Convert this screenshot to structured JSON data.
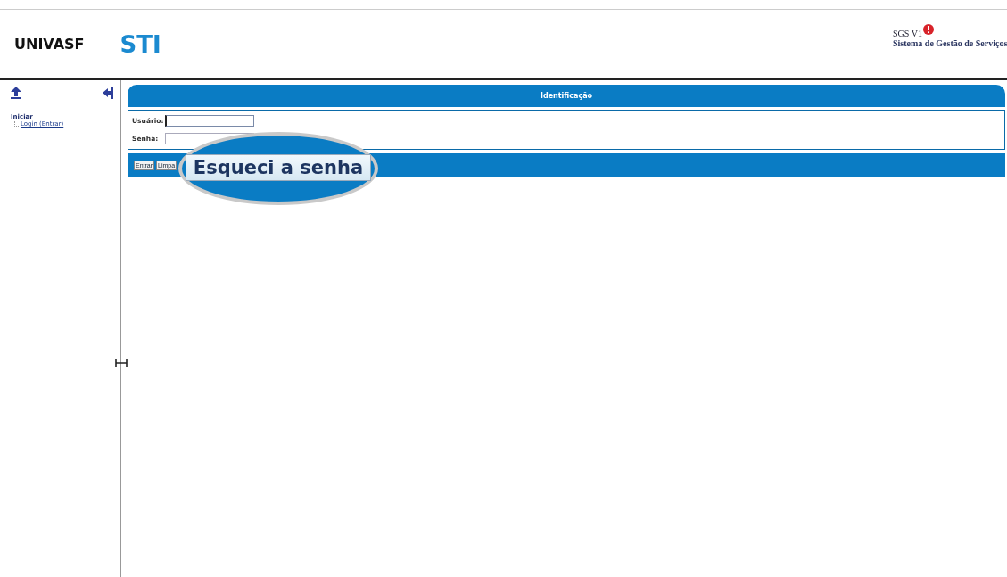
{
  "header": {
    "logos": [
      "UNIVASF",
      "STI"
    ],
    "app_name": "SGS V1",
    "app_subtitle": "Sistema de Gestão de Serviços"
  },
  "sidebar": {
    "section": "Iniciar",
    "items": [
      {
        "label": "Login (Entrar)"
      }
    ]
  },
  "panel": {
    "title": "Identificação",
    "fields": [
      {
        "label": "Usuário:",
        "focused": true
      },
      {
        "label": "Senha:",
        "focused": false
      }
    ],
    "buttons": [
      "Entrar",
      "Limpa"
    ]
  },
  "magnifier": {
    "button": "Esqueci a senha"
  }
}
